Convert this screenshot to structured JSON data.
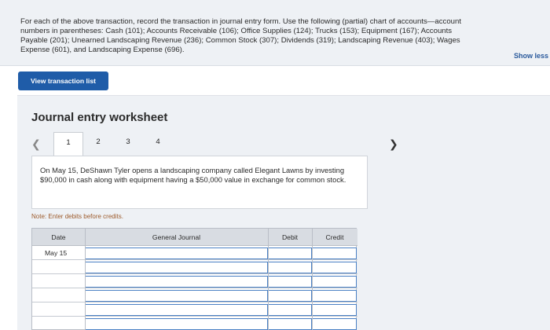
{
  "instructions": {
    "text": "For each of the above transaction, record the transaction in journal entry form. Use the following (partial) chart of accounts—account\nnumbers in parentheses: Cash (101); Accounts Receivable (106); Office Supplies (124); Trucks (153); Equipment (167); Accounts\nPayable (201); Unearned Landscaping Revenue (236); Common Stock (307); Dividends (319); Landscaping Revenue (403); Wages\nExpense (601), and Landscaping Expense (696).",
    "show_less": "Show less"
  },
  "view_transaction_list_label": "View transaction list",
  "worksheet": {
    "title": "Journal entry worksheet",
    "pages": [
      "1",
      "2",
      "3",
      "4"
    ],
    "active_page": "1",
    "scenario": "On May 15, DeShawn Tyler opens a landscaping company called Elegant Lawns by investing $90,000 in cash along with equipment having a $50,000 value in exchange for common stock.",
    "note": "Note: Enter debits before credits."
  },
  "journal_table": {
    "headers": {
      "date": "Date",
      "general_journal": "General Journal",
      "debit": "Debit",
      "credit": "Credit"
    },
    "rows": [
      {
        "date": "May 15",
        "account": "",
        "debit": "",
        "credit": ""
      },
      {
        "date": "",
        "account": "",
        "debit": "",
        "credit": ""
      },
      {
        "date": "",
        "account": "",
        "debit": "",
        "credit": ""
      },
      {
        "date": "",
        "account": "",
        "debit": "",
        "credit": ""
      },
      {
        "date": "",
        "account": "",
        "debit": "",
        "credit": ""
      },
      {
        "date": "",
        "account": "",
        "debit": "",
        "credit": ""
      }
    ]
  },
  "colors": {
    "primary_button": "#1f5ca8",
    "panel_bg": "#eef1f5",
    "input_border": "#4a80c4",
    "note_text": "#9c5a2b"
  }
}
